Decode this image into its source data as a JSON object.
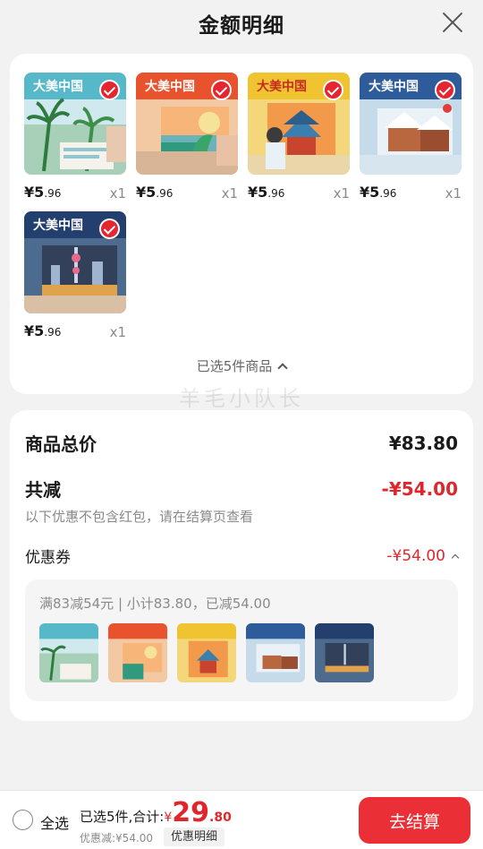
{
  "header": {
    "title": "金额明细"
  },
  "products": [
    {
      "price_int": "¥5",
      "price_dec": ".96",
      "qty": "x1",
      "scene": "tropical",
      "selected": true
    },
    {
      "price_int": "¥5",
      "price_dec": ".96",
      "qty": "x1",
      "scene": "sunset",
      "selected": true
    },
    {
      "price_int": "¥5",
      "price_dec": ".96",
      "qty": "x1",
      "scene": "temple",
      "selected": true
    },
    {
      "price_int": "¥5",
      "price_dec": ".96",
      "qty": "x1",
      "scene": "snow",
      "selected": true
    },
    {
      "price_int": "¥5",
      "price_dec": ".96",
      "qty": "x1",
      "scene": "city",
      "selected": true
    }
  ],
  "book_title": "大美中国",
  "selected_summary": "已选5件商品",
  "watermark": "羊毛小队长",
  "totals": {
    "total_label": "商品总价",
    "total_value": "¥83.80",
    "discount_label": "共减",
    "discount_value": "-¥54.00",
    "note": "以下优惠不包含红包，请在结算页查看",
    "coupon_label": "优惠券",
    "coupon_value": "-¥54.00",
    "coupon_desc": "满83减54元 | 小计83.80，已减54.00"
  },
  "footer": {
    "select_all": "全选",
    "selected_text": "已选5件,合计:",
    "yen": "¥",
    "amount_int": "29",
    "amount_dec": ".80",
    "saved": "优惠减:¥54.00",
    "detail_button": "优惠明细",
    "checkout_button": "去结算"
  },
  "colors": {
    "accent": "#e0262d",
    "checkout": "#ea3036"
  }
}
